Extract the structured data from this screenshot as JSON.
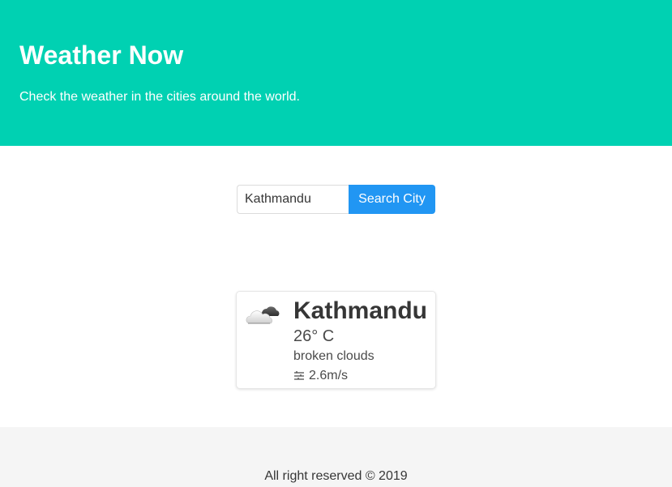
{
  "header": {
    "title": "Weather Now",
    "subtitle": "Check the weather in the cities around the world.",
    "background_color": "#00d1b2"
  },
  "search": {
    "input_value": "Kathmandu",
    "button_label": "Search City",
    "button_color": "#2196f3"
  },
  "weather_card": {
    "icon": "broken-clouds-icon",
    "city": "Kathmandu",
    "temperature": "26° C",
    "description": "broken clouds",
    "wind_icon": "wind-icon",
    "wind_speed": "2.6m/s"
  },
  "footer": {
    "text": "All right reserved © 2019"
  }
}
